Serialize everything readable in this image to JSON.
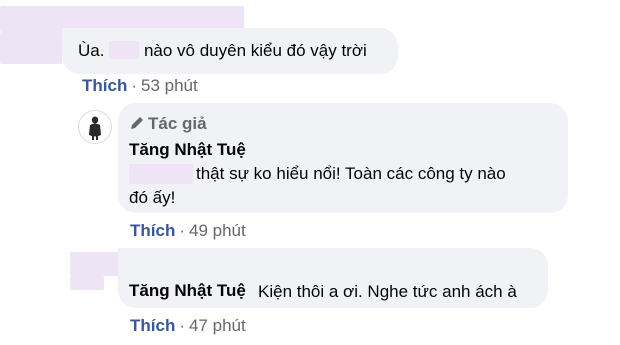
{
  "comments": [
    {
      "text_prefix": "Ùa.",
      "text_suffix": "nào vô duyên kiểu đó vậy trời",
      "like_label": "Thích",
      "dot": "·",
      "time": "53 phút"
    },
    {
      "author_badge": "Tác giả",
      "author_name": "Tăng Nhật Tuệ",
      "text_line1": "thật sự ko hiểu nổi! Toàn các công ty nào",
      "text_line2": "đó ấy!",
      "like_label": "Thích",
      "dot": "·",
      "time": "49 phút",
      "pencil_icon": "pencil-icon"
    },
    {
      "author_name": "Tăng Nhật Tuệ",
      "text": "Kiện thôi a ơi. Nghe tức anh ách à",
      "like_label": "Thích",
      "dot": "·",
      "time": "47 phút"
    }
  ],
  "colors": {
    "bubble": "#f0f2f5",
    "link": "#385898",
    "meta": "#65676b",
    "redaction": "#efe4f6"
  }
}
